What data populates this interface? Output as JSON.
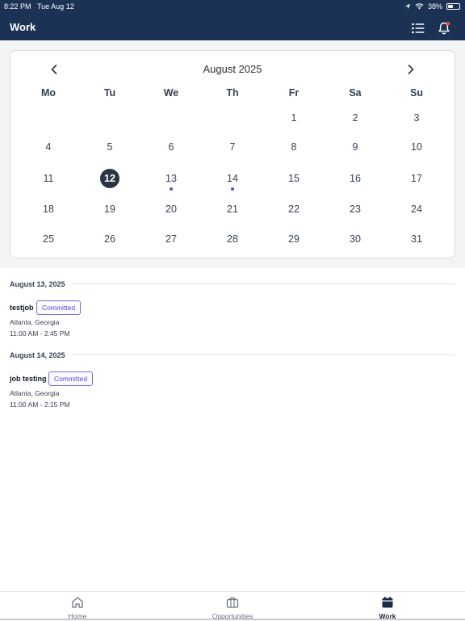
{
  "status_bar": {
    "time": "8:22 PM",
    "date": "Tue Aug 12",
    "battery": "38%"
  },
  "header": {
    "title": "Work"
  },
  "calendar": {
    "month_label": "August 2025",
    "weekdays": [
      "Mo",
      "Tu",
      "We",
      "Th",
      "Fr",
      "Sa",
      "Su"
    ],
    "weeks": [
      [
        "",
        "",
        "",
        "",
        "1",
        "2",
        "3"
      ],
      [
        "4",
        "5",
        "6",
        "7",
        "8",
        "9",
        "10"
      ],
      [
        "11",
        "12",
        "13",
        "14",
        "15",
        "16",
        "17"
      ],
      [
        "18",
        "19",
        "20",
        "21",
        "22",
        "23",
        "24"
      ],
      [
        "25",
        "26",
        "27",
        "28",
        "29",
        "30",
        "31"
      ]
    ],
    "selected_day": "12",
    "event_days": [
      "13",
      "14"
    ]
  },
  "schedule": [
    {
      "date": "August 13, 2025",
      "jobs": [
        {
          "title": "testjob",
          "status": "Committed",
          "location": "Atlanta, Georgia",
          "time": "11:00 AM - 2:45 PM"
        }
      ]
    },
    {
      "date": "August 14, 2025",
      "jobs": [
        {
          "title": "job testing",
          "status": "Committed",
          "location": "Atlanta, Georgia",
          "time": "11:00 AM - 2:15 PM"
        }
      ]
    }
  ],
  "tabs": [
    {
      "label": "Home",
      "icon": "home-icon",
      "active": false
    },
    {
      "label": "Opportunities",
      "icon": "briefcase-icon",
      "active": false
    },
    {
      "label": "Work",
      "icon": "calendar-icon",
      "active": true
    }
  ],
  "colors": {
    "header_bg": "#1b3254",
    "accent": "#5b47d6",
    "selected_day_bg": "#2b3444",
    "notification_dot": "#ef4444"
  }
}
